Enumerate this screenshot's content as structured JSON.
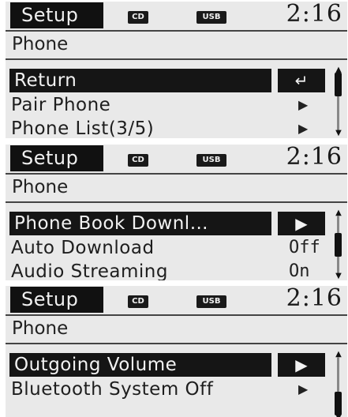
{
  "screens": [
    {
      "status": {
        "tab": "Setup",
        "cd": "CD",
        "usb": "USB",
        "time": "2:16"
      },
      "header": "Phone",
      "items": [
        {
          "label": "Return",
          "selected": true,
          "btn": "↵"
        },
        {
          "label": "Pair Phone",
          "arrow": "▶"
        },
        {
          "label": "Phone List(3/5)",
          "arrow": "▶"
        }
      ],
      "scroll": {
        "up": "▲",
        "down": "▼"
      }
    },
    {
      "status": {
        "tab": "Setup",
        "cd": "CD",
        "usb": "USB",
        "time": "2:16"
      },
      "header": "Phone",
      "items": [
        {
          "label": "Phone Book Downl…",
          "selected": true,
          "btn": "▶"
        },
        {
          "label": "Auto Download",
          "value": "Off"
        },
        {
          "label": "Audio Streaming",
          "value": "On"
        }
      ],
      "scroll": {
        "up": "▲",
        "down": "▼"
      }
    },
    {
      "status": {
        "tab": "Setup",
        "cd": "CD",
        "usb": "USB",
        "time": "2:16"
      },
      "header": "Phone",
      "items": [
        {
          "label": "Outgoing Volume",
          "selected": true,
          "btn": "▶"
        },
        {
          "label": "Bluetooth System Off",
          "arrow": "▶"
        }
      ],
      "scroll": {
        "up": "▲",
        "down": "▼"
      }
    }
  ],
  "colors": {
    "screen_bg": "#e9e9e9",
    "selection": "#151515",
    "text": "#1e1e1e"
  }
}
